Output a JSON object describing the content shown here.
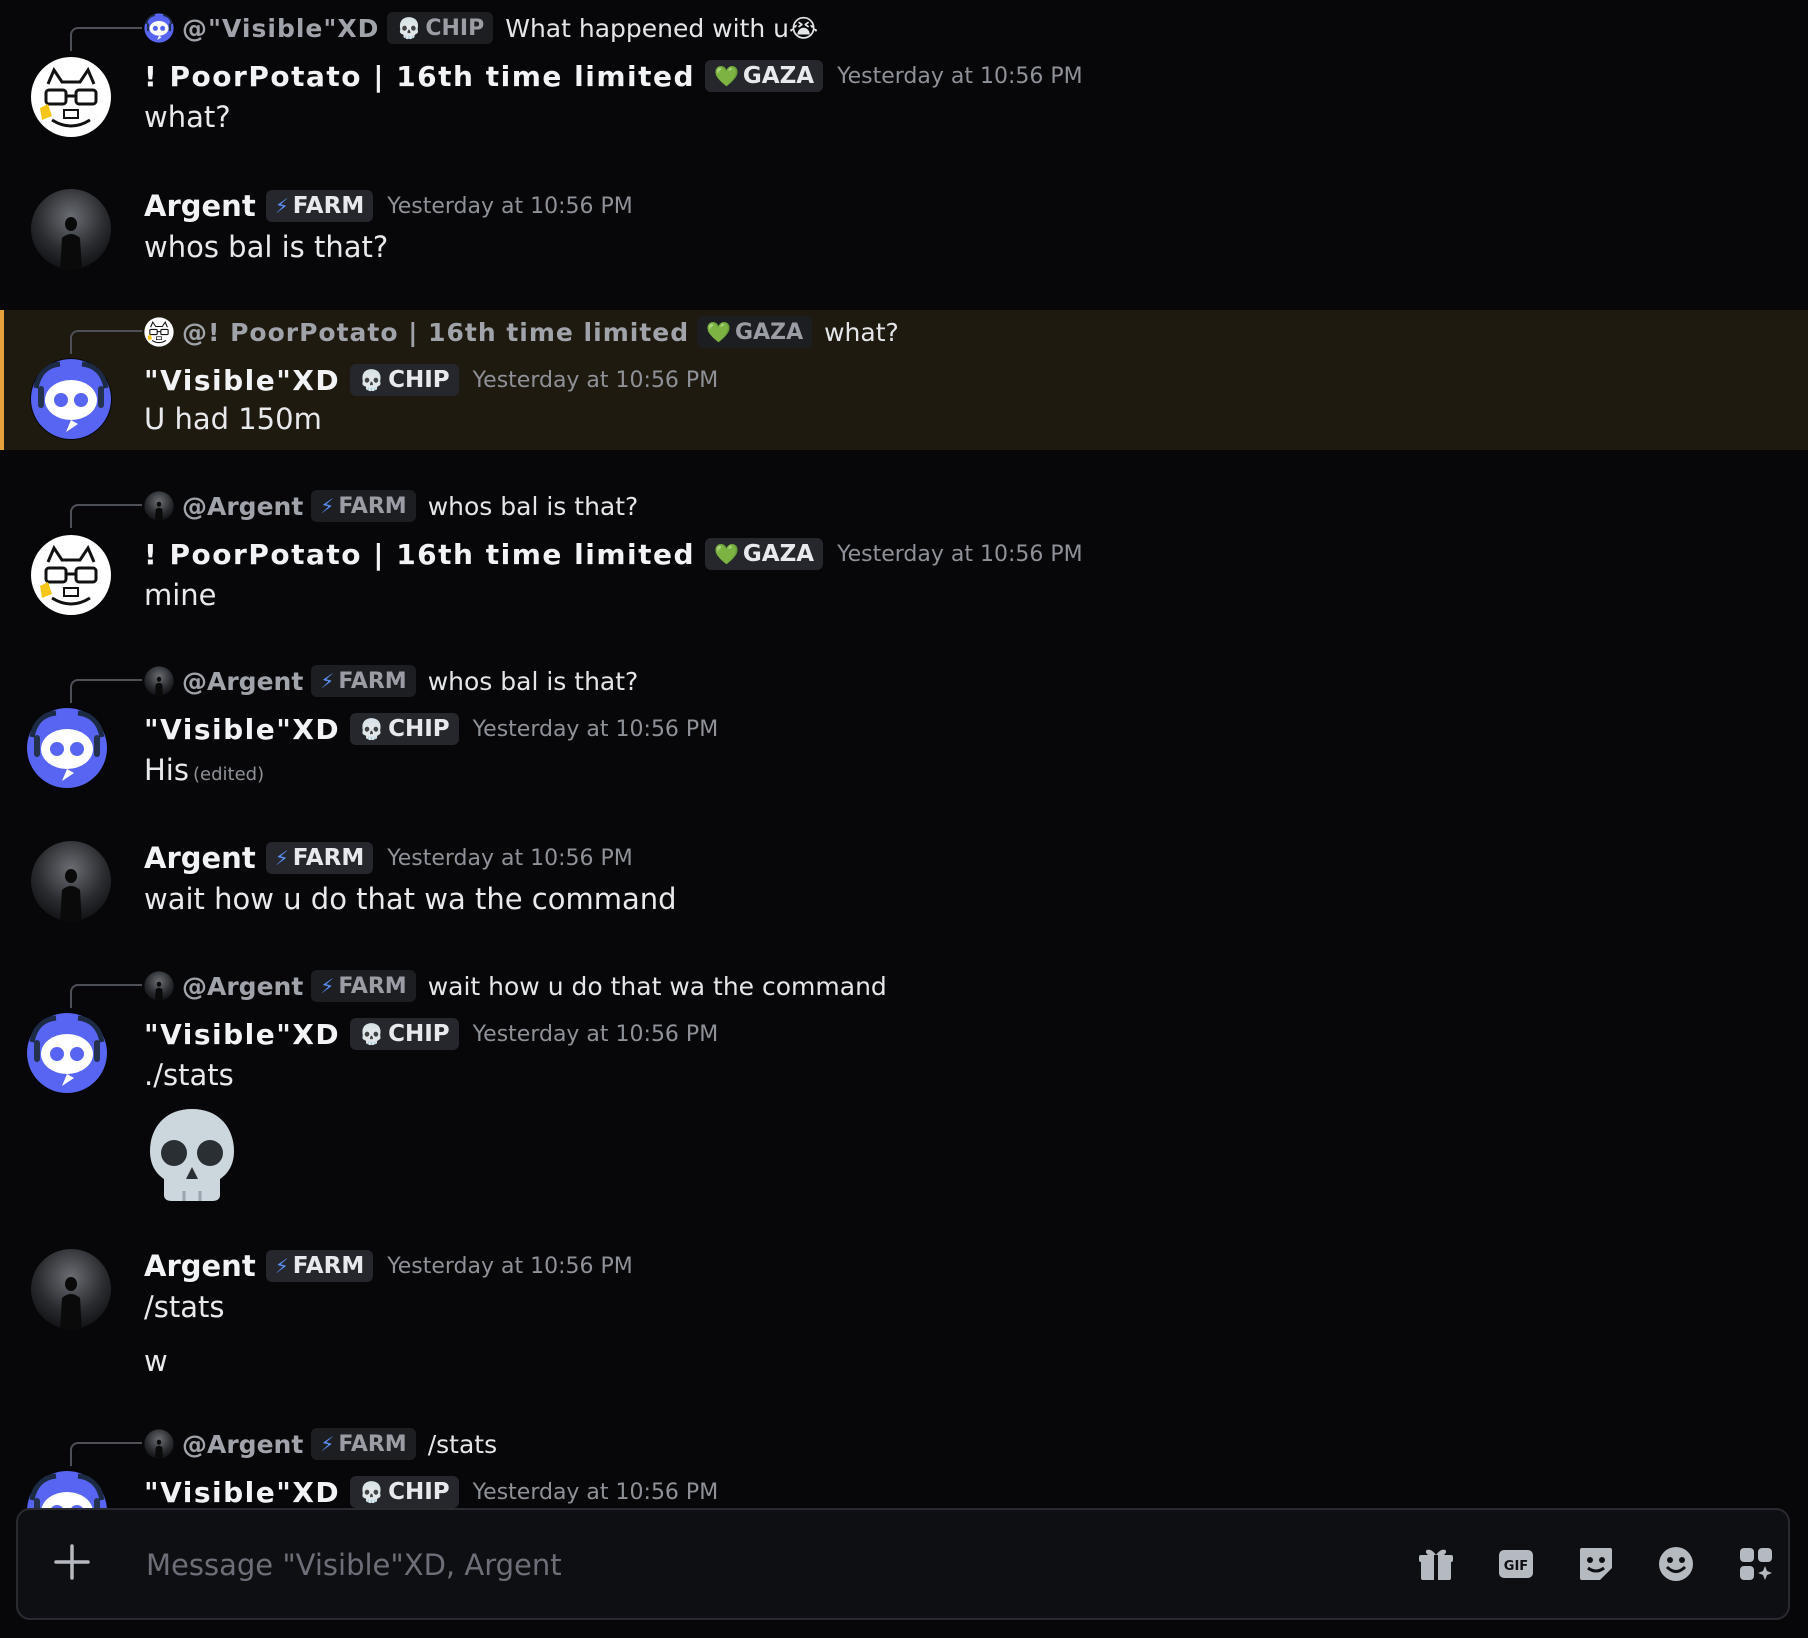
{
  "users": {
    "visible": {
      "name": "\"Visible\"XD",
      "tag": "CHIP",
      "tag_icon": "skull-icon"
    },
    "potato": {
      "name": "! PoorPotato | 16th time limited",
      "tag": "GAZA",
      "tag_icon": "heart-icon"
    },
    "argent": {
      "name": "Argent",
      "tag": "FARM",
      "tag_icon": "lightning-icon"
    }
  },
  "messages": [
    {
      "reply_to": "@\"Visible\"XD",
      "reply_tag": "CHIP",
      "reply_text": "What happened with u😭",
      "author": "! PoorPotato | 16th time limited",
      "tag": "GAZA",
      "timestamp": "Yesterday at 10:56 PM",
      "text": "what?"
    },
    {
      "author": "Argent",
      "tag": "FARM",
      "timestamp": "Yesterday at 10:56 PM",
      "text": "whos bal is  that?"
    },
    {
      "reply_to": "@! PoorPotato | 16th time limited",
      "reply_tag": "GAZA",
      "reply_text": "what?",
      "author": "\"Visible\"XD",
      "tag": "CHIP",
      "timestamp": "Yesterday at 10:56 PM",
      "text": "U had 150m",
      "highlighted": true
    },
    {
      "reply_to": "@Argent",
      "reply_tag": "FARM",
      "reply_text": "whos bal is  that?",
      "author": "! PoorPotato | 16th time limited",
      "tag": "GAZA",
      "timestamp": "Yesterday at 10:56 PM",
      "text": "mine"
    },
    {
      "reply_to": "@Argent",
      "reply_tag": "FARM",
      "reply_text": "whos bal is  that?",
      "author": "\"Visible\"XD",
      "tag": "CHIP",
      "timestamp": "Yesterday at 10:56 PM",
      "text": "His",
      "edited": "(edited)"
    },
    {
      "author": "Argent",
      "tag": "FARM",
      "timestamp": "Yesterday at 10:56 PM",
      "text": "wait how u do that wa the command"
    },
    {
      "reply_to": "@Argent",
      "reply_tag": "FARM",
      "reply_text": "wait how u do that wa the command",
      "author": "\"Visible\"XD",
      "tag": "CHIP",
      "timestamp": "Yesterday at 10:56 PM",
      "text": "./stats",
      "emoji": "skull-emoji"
    },
    {
      "author": "Argent",
      "tag": "FARM",
      "timestamp": "Yesterday at 10:56 PM",
      "text": "/stats",
      "text2": "w"
    },
    {
      "reply_to": "@Argent",
      "reply_tag": "FARM",
      "reply_text": "/stats",
      "author": "\"Visible\"XD",
      "tag": "CHIP",
      "timestamp": "Yesterday at 10:56 PM"
    }
  ],
  "composer": {
    "placeholder": "Message \"Visible\"XD, Argent"
  },
  "colors": {
    "background": "#070709",
    "highlight": "#1f1a10",
    "highlight_bar": "#e6a23c",
    "discord_blurple": "#5865f2"
  }
}
